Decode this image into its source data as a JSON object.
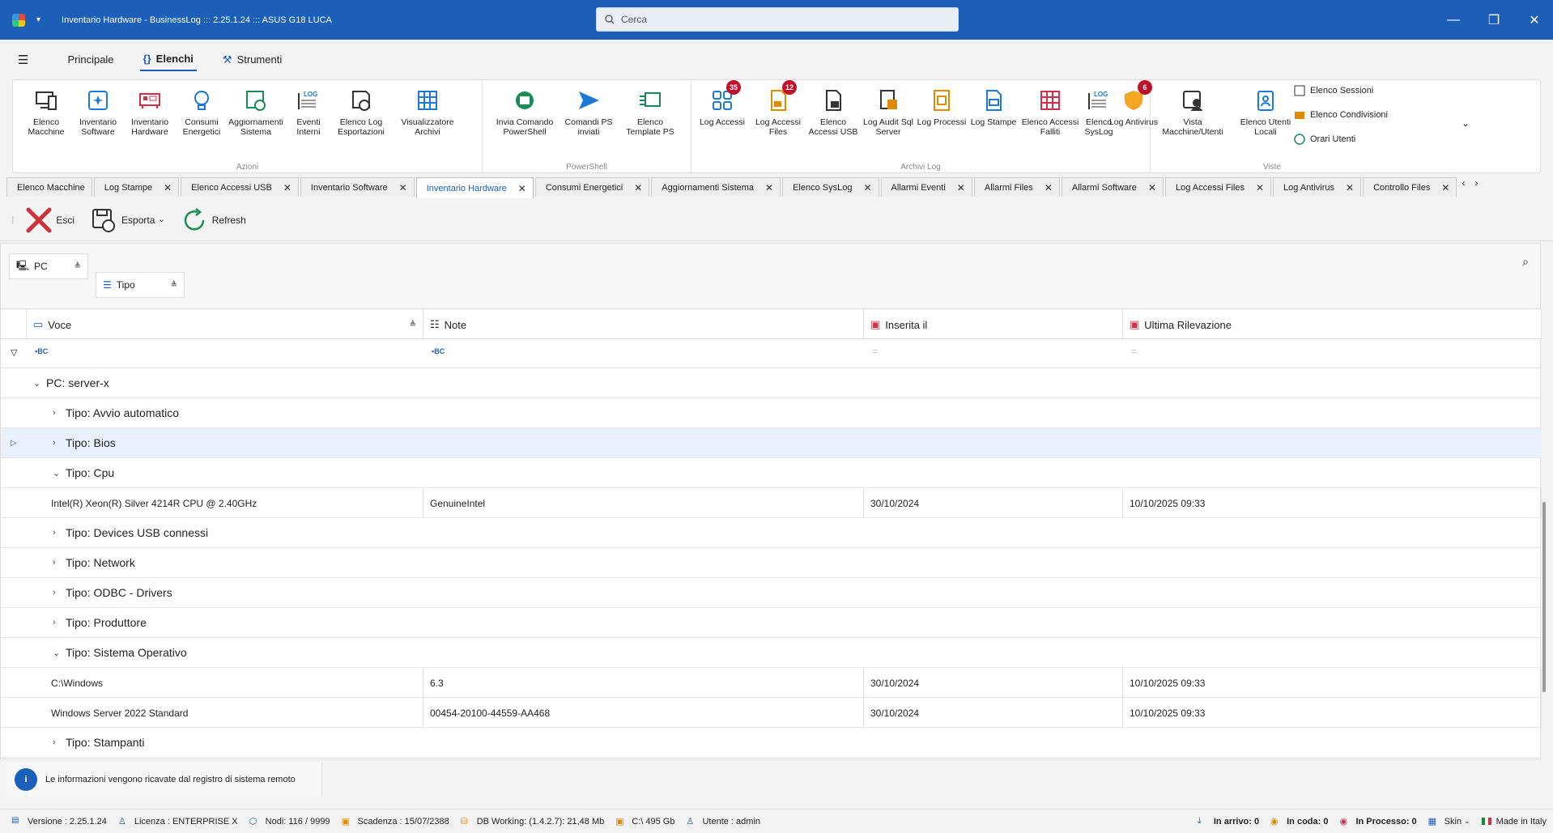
{
  "window": {
    "title": "Inventario Hardware - BusinessLog ::: 2.25.1.24 ::: ASUS G18 LUCA",
    "search_placeholder": "Cerca"
  },
  "menu": {
    "principale": "Principale",
    "elenchi": "Elenchi",
    "strumenti": "Strumenti"
  },
  "ribbon": {
    "azioni": {
      "label": "Azioni",
      "items": [
        "Elenco Macchine",
        "Inventario Software",
        "Inventario Hardware",
        "Consumi Energetici",
        "Aggiornamenti Sistema",
        "Eventi Interni",
        "Elenco Log Esportazioni",
        "Visualizzatore Archivi"
      ]
    },
    "powershell": {
      "label": "PowerShell",
      "items": [
        "Invia Comando PowerShell",
        "Comandi PS inviati",
        "Elenco Template PS"
      ]
    },
    "archivi": {
      "label": "Archivi Log",
      "items": [
        "Log Accessi",
        "Log Accessi Files",
        "Elenco Accessi USB",
        "Log Audit Sql Server",
        "Log Processi",
        "Log Stampe",
        "Elenco Accessi Falliti",
        "Elenco SysLog",
        "Log Antivirus"
      ],
      "badges": {
        "log_accessi": "35",
        "log_accessi_files": "12",
        "log_antivirus": "6"
      }
    },
    "viste": {
      "label": "Viste",
      "items": [
        "Vista Macchine/Utenti",
        "Elenco Utenti Locali"
      ],
      "small": [
        "Elenco Sessioni",
        "Elenco Condivisioni",
        "Orari Utenti"
      ]
    }
  },
  "tabs": [
    "Elenco Macchine",
    "Log Stampe",
    "Elenco Accessi USB",
    "Inventario Software",
    "Inventario Hardware",
    "Consumi Energetici",
    "Aggiornamenti Sistema",
    "Elenco SysLog",
    "Allarmi Eventi",
    "Allarmi Files",
    "Allarmi Software",
    "Log Accessi Files",
    "Log Antivirus",
    "Controllo Files"
  ],
  "toolbar": {
    "esci": "Esci",
    "esporta": "Esporta",
    "refresh": "Refresh"
  },
  "grouping": {
    "pc": "PC",
    "tipo": "Tipo"
  },
  "columns": {
    "voce": "Voce",
    "note": "Note",
    "inserita": "Inserita il",
    "ultima": "Ultima Rilevazione"
  },
  "rows": [
    {
      "kind": "g1",
      "text": "PC: server-x",
      "open": true
    },
    {
      "kind": "g2",
      "text": "Tipo: Avvio automatico",
      "open": false
    },
    {
      "kind": "g2",
      "text": "Tipo: Bios",
      "open": false,
      "hl": true
    },
    {
      "kind": "g2",
      "text": "Tipo: Cpu",
      "open": true
    },
    {
      "kind": "d",
      "voce": "Intel(R) Xeon(R) Silver 4214R CPU @ 2.40GHz",
      "note": "GenuineIntel",
      "inserita": "30/10/2024",
      "ultima": "10/10/2025 09:33"
    },
    {
      "kind": "g2",
      "text": "Tipo: Devices USB connessi",
      "open": false
    },
    {
      "kind": "g2",
      "text": "Tipo: Network",
      "open": false
    },
    {
      "kind": "g2",
      "text": "Tipo: ODBC - Drivers",
      "open": false
    },
    {
      "kind": "g2",
      "text": "Tipo: Produttore",
      "open": false
    },
    {
      "kind": "g2",
      "text": "Tipo: Sistema Operativo",
      "open": true
    },
    {
      "kind": "d",
      "voce": "C:\\Windows",
      "note": "6.3",
      "inserita": "30/10/2024",
      "ultima": "10/10/2025 09:33"
    },
    {
      "kind": "d",
      "voce": "Windows Server 2022 Standard",
      "note": "00454-20100-44559-AA468",
      "inserita": "30/10/2024",
      "ultima": "10/10/2025 09:33"
    },
    {
      "kind": "g2",
      "text": "Tipo: Stampanti",
      "open": false
    }
  ],
  "info": "Le informazioni vengono ricavate dal registro di sistema remoto",
  "status": {
    "versione": "Versione : 2.25.1.24",
    "licenza": "Licenza : ENTERPRISE X",
    "nodi": "Nodi: 116 / 9999",
    "scadenza": "Scadenza : 15/07/2388",
    "db": "DB Working: (1.4.2.7): 21,48 Mb",
    "disk": "C:\\ 495 Gb",
    "utente": "Utente : admin",
    "arrivo": "In arrivo: 0",
    "coda": "In coda: 0",
    "processo": "In Processo: 0",
    "skin": "Skin",
    "made": "Made in Italy"
  },
  "colors": {
    "accent": "#1b5fb8",
    "badge": "#c0102a"
  }
}
